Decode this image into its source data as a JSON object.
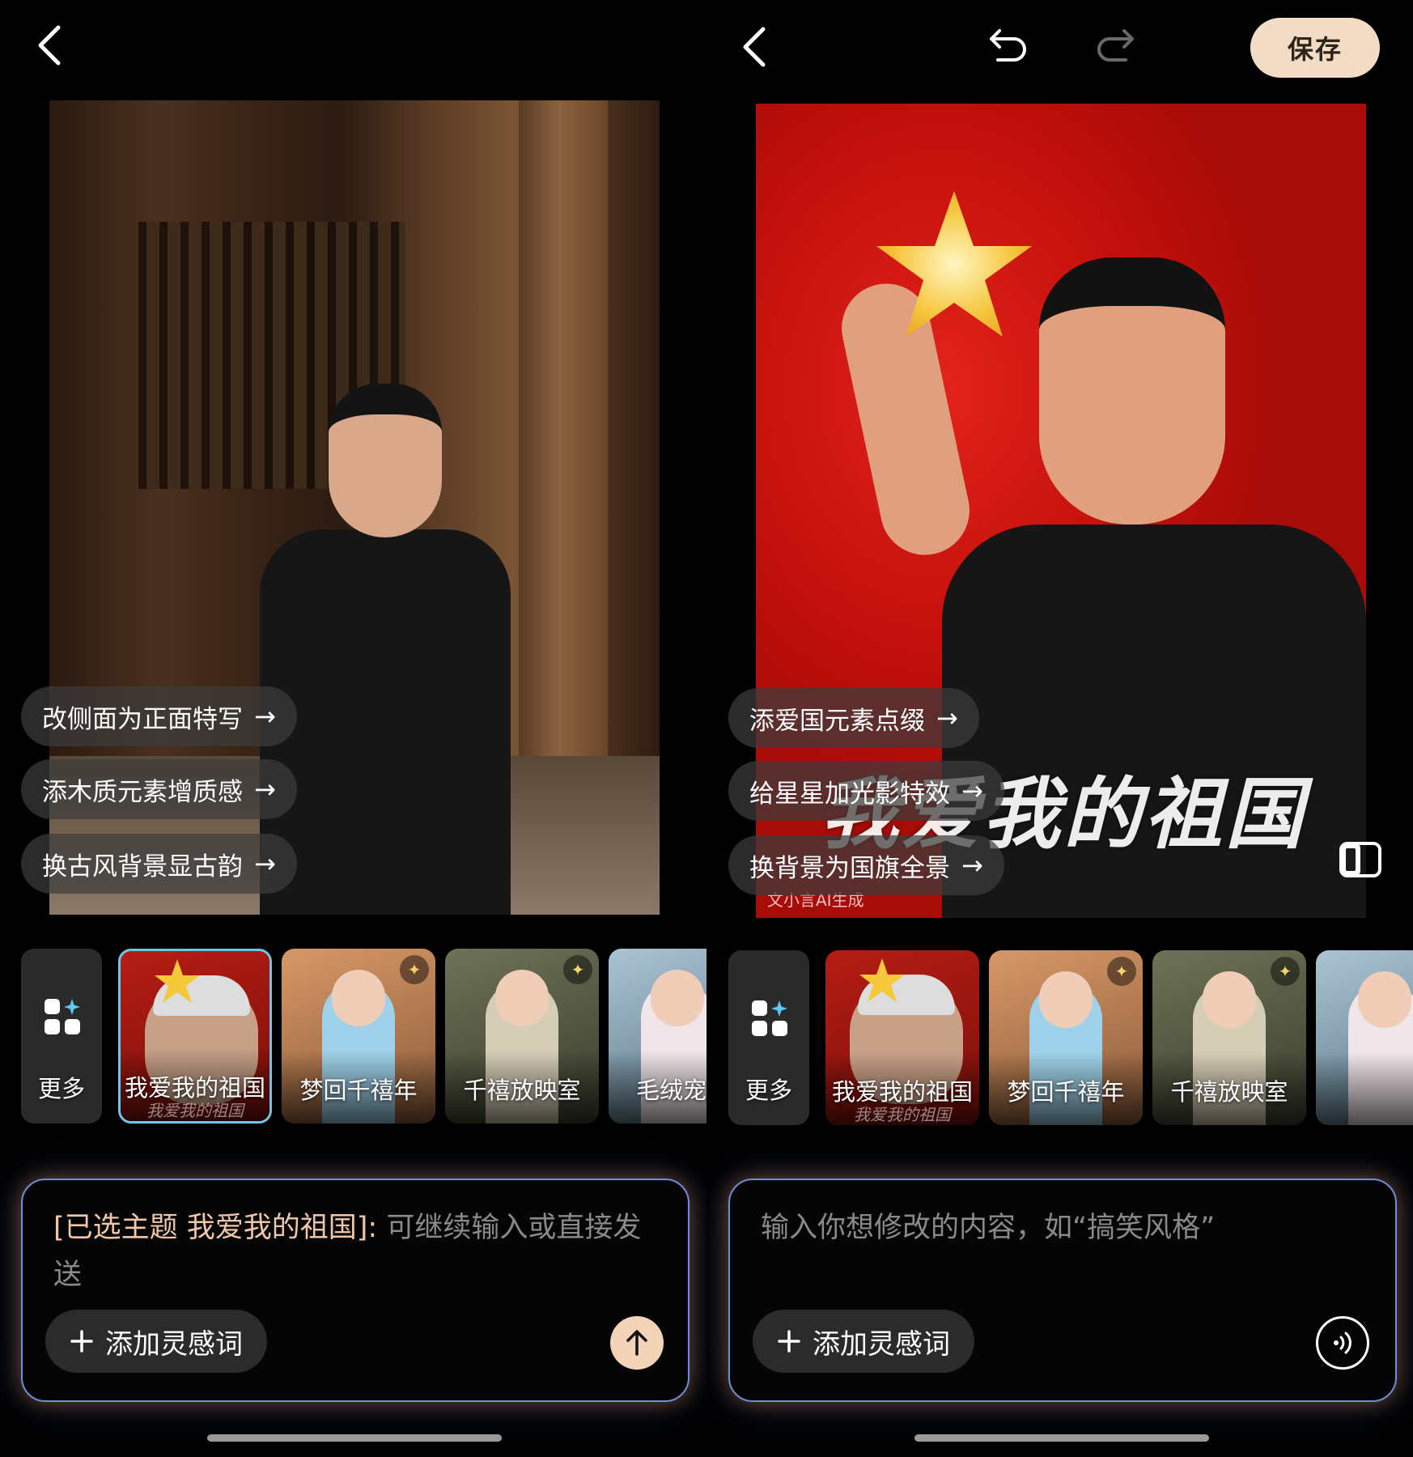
{
  "left": {
    "chips": [
      {
        "label": "改侧面为正面特写",
        "arrow": "→"
      },
      {
        "label": "添木质元素增质感",
        "arrow": "→"
      },
      {
        "label": "换古风背景显古韵",
        "arrow": "→"
      }
    ],
    "tools": {
      "more_label": "更多",
      "items": [
        {
          "label": "我爱我的祖国",
          "sub": "我爱我的祖国",
          "selected": true
        },
        {
          "label": "梦回千禧年"
        },
        {
          "label": "千禧放映室"
        },
        {
          "label": "毛绒宠"
        }
      ]
    },
    "input": {
      "topic": "[已选主题 我爱我的祖国]:",
      "hint": "可继续输入或直接发送",
      "add_inspiration": "添加灵感词"
    }
  },
  "right": {
    "save_label": "保存",
    "watermark": "我爱我的祖国",
    "ai_label": "文小言AI生成",
    "chips": [
      {
        "label": "添爱国元素点缀",
        "arrow": "→"
      },
      {
        "label": "给星星加光影特效",
        "arrow": "→"
      },
      {
        "label": "换背景为国旗全景",
        "arrow": "→"
      }
    ],
    "tools": {
      "more_label": "更多",
      "items": [
        {
          "label": "我爱我的祖国",
          "sub": "我爱我的祖国"
        },
        {
          "label": "梦回千禧年"
        },
        {
          "label": "千禧放映室"
        },
        {
          "label": ""
        }
      ]
    },
    "input": {
      "placeholder": "输入你想修改的内容，如“搞笑风格”",
      "add_inspiration": "添加灵感词"
    }
  },
  "colors": {
    "accent": "#f3dcc5",
    "selected_border": "#6dc6e8",
    "panel_glow_orange": "#e88246",
    "panel_glow_blue": "#6b8fd8",
    "flag_red": "#c4100c"
  },
  "icons": [
    "back-icon",
    "undo-icon",
    "redo-icon",
    "compare-icon",
    "more-grid-icon",
    "plus-icon",
    "send-arrow-icon",
    "voice-icon",
    "star-icon"
  ]
}
